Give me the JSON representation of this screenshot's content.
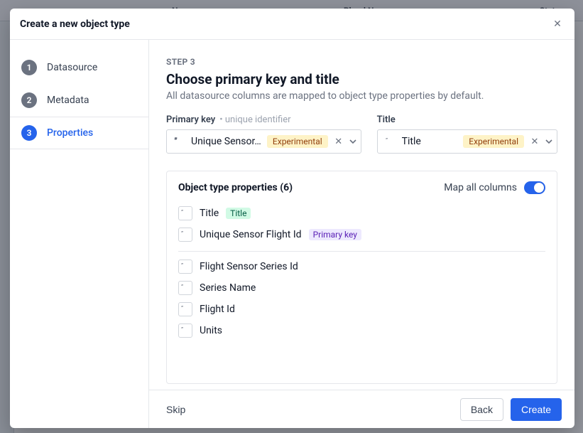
{
  "bg": {
    "col_name": "Name",
    "col_plural": "Plural Name",
    "col_status": "Status"
  },
  "modal": {
    "title": "Create a new object type",
    "steps": [
      {
        "num": "1",
        "label": "Datasource"
      },
      {
        "num": "2",
        "label": "Metadata"
      },
      {
        "num": "3",
        "label": "Properties"
      }
    ],
    "step_caption": "STEP 3",
    "heading": "Choose primary key and title",
    "subheading": "All datasource columns are mapped to object type properties by default.",
    "pk_label": "Primary key",
    "pk_hint": "• unique identifier",
    "pk_value": "Unique Sensor…",
    "pk_badge": "Experimental",
    "title_label": "Title",
    "title_value": "Title",
    "title_badge": "Experimental",
    "props_title_prefix": "Object type properties (",
    "props_count": "6",
    "props_title_suffix": ")",
    "map_all_label": "Map all columns",
    "title_badge_small": "Title",
    "pk_badge_small": "Primary key",
    "properties": [
      "Title",
      "Unique Sensor Flight Id",
      "Flight Sensor Series Id",
      "Series Name",
      "Flight Id",
      "Units"
    ],
    "skip": "Skip",
    "back": "Back",
    "create": "Create"
  }
}
